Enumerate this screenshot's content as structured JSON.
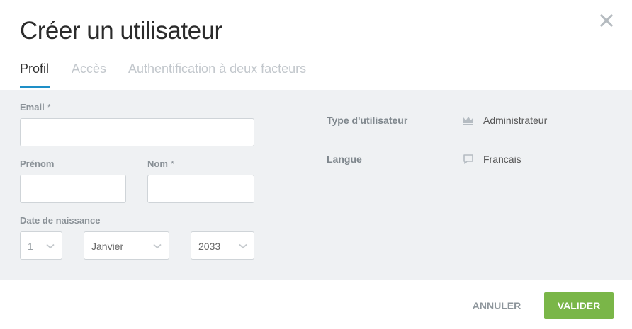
{
  "dialog": {
    "title": "Créer un utilisateur",
    "close_icon": "close-icon"
  },
  "tabs": [
    {
      "label": "Profil",
      "active": true
    },
    {
      "label": "Accès",
      "active": false
    },
    {
      "label": "Authentification à deux facteurs",
      "active": false
    }
  ],
  "form": {
    "email": {
      "label": "Email",
      "required_mark": "*",
      "value": ""
    },
    "first_name": {
      "label": "Prénom",
      "value": ""
    },
    "last_name": {
      "label": "Nom",
      "required_mark": "*",
      "value": ""
    },
    "birth_date": {
      "label": "Date de naissance",
      "day": "1",
      "month": "Janvier",
      "year": "2033"
    }
  },
  "info": {
    "user_type": {
      "label": "Type d'utilisateur",
      "icon": "crown-icon",
      "value": "Administrateur"
    },
    "language": {
      "label": "Langue",
      "icon": "speech-bubble-icon",
      "value": "Francais"
    }
  },
  "footer": {
    "cancel_label": "ANNULER",
    "validate_label": "VALIDER"
  },
  "colors": {
    "accent": "#1e8fc7",
    "primary_button": "#7ab648",
    "panel_background": "#eff1f3"
  }
}
